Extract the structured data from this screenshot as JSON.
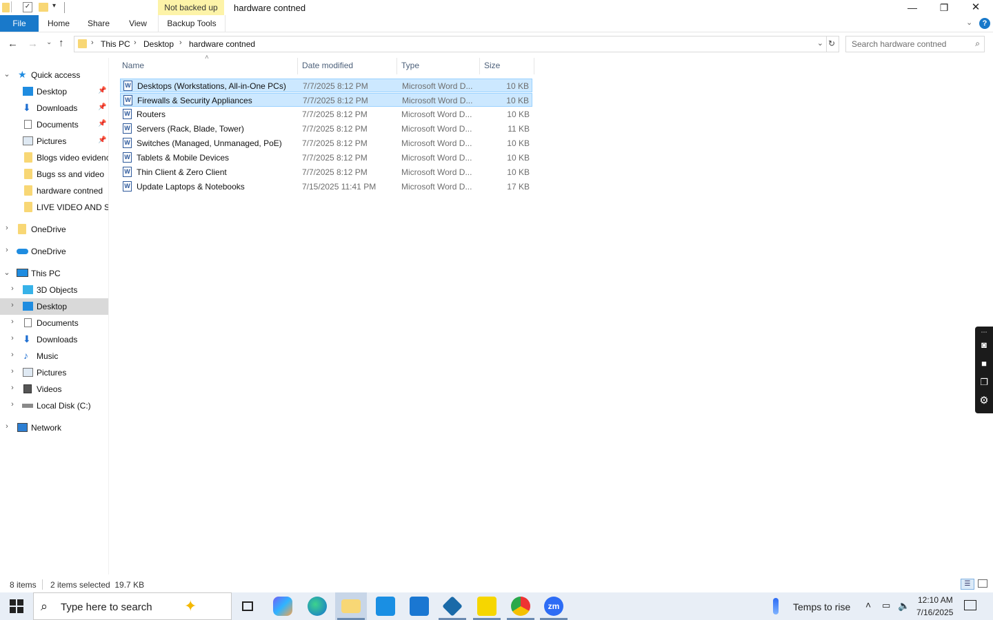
{
  "titlebar": {
    "context_tab": "Not backed up",
    "title": "hardware contned",
    "minimize": "—",
    "restore": "❐",
    "close": "✕"
  },
  "ribbon": {
    "tabs": [
      "File",
      "Home",
      "Share",
      "View",
      "Backup Tools"
    ],
    "help": "?"
  },
  "address": {
    "crumbs": [
      "This PC",
      "Desktop",
      "hardware contned"
    ],
    "search_placeholder": "Search hardware contned"
  },
  "nav": {
    "quick_access": "Quick access",
    "quick_items": [
      "Desktop",
      "Downloads",
      "Documents",
      "Pictures",
      "Blogs video evidenc",
      "Bugs ss and  video",
      "hardware contned",
      "LIVE VIDEO AND SS"
    ],
    "onedrive1": "OneDrive",
    "onedrive2": "OneDrive",
    "this_pc": "This PC",
    "pc_items": [
      "3D Objects",
      "Desktop",
      "Documents",
      "Downloads",
      "Music",
      "Pictures",
      "Videos",
      "Local Disk (C:)"
    ],
    "network": "Network"
  },
  "columns": {
    "name": "Name",
    "date": "Date modified",
    "type": "Type",
    "size": "Size"
  },
  "files": [
    {
      "name": "Desktops (Workstations, All-in-One PCs)",
      "date": "7/7/2025 8:12 PM",
      "type": "Microsoft Word D...",
      "size": "10 KB",
      "selected": true
    },
    {
      "name": "Firewalls & Security Appliances",
      "date": "7/7/2025 8:12 PM",
      "type": "Microsoft Word D...",
      "size": "10 KB",
      "selected": true
    },
    {
      "name": "Routers",
      "date": "7/7/2025 8:12 PM",
      "type": "Microsoft Word D...",
      "size": "10 KB",
      "selected": false
    },
    {
      "name": "Servers (Rack, Blade, Tower)",
      "date": "7/7/2025 8:12 PM",
      "type": "Microsoft Word D...",
      "size": "11 KB",
      "selected": false
    },
    {
      "name": "Switches (Managed, Unmanaged, PoE)",
      "date": "7/7/2025 8:12 PM",
      "type": "Microsoft Word D...",
      "size": "10 KB",
      "selected": false
    },
    {
      "name": "Tablets & Mobile Devices",
      "date": "7/7/2025 8:12 PM",
      "type": "Microsoft Word D...",
      "size": "10 KB",
      "selected": false
    },
    {
      "name": "Thin Client & Zero Client",
      "date": "7/7/2025 8:12 PM",
      "type": "Microsoft Word D...",
      "size": "10 KB",
      "selected": false
    },
    {
      "name": "Update Laptops & Notebooks",
      "date": "7/15/2025 11:41 PM",
      "type": "Microsoft Word D...",
      "size": "17 KB",
      "selected": false
    }
  ],
  "status": {
    "items": "8 items",
    "selected": "2 items selected  19.7 KB"
  },
  "taskbar": {
    "search_placeholder": "Type here to search",
    "weather": "Temps to rise",
    "time": "12:10 AM",
    "date": "7/16/2025",
    "zoom_label": "zm"
  },
  "colors": {
    "accent": "#1979ca",
    "selection": "#cce8ff",
    "folder": "#f8d775",
    "context_tab": "#fdf3a8"
  }
}
